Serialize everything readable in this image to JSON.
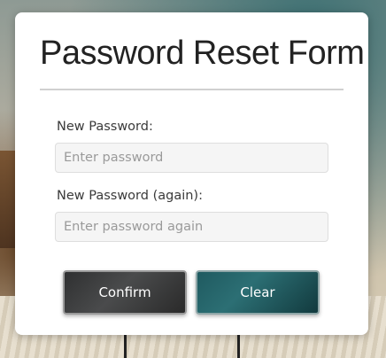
{
  "form": {
    "title": "Password Reset Form",
    "new_password": {
      "label": "New Password:",
      "placeholder": "Enter password",
      "value": ""
    },
    "new_password_again": {
      "label": "New Password (again):",
      "placeholder": "Enter password again",
      "value": ""
    },
    "confirm_label": "Confirm",
    "clear_label": "Clear"
  }
}
